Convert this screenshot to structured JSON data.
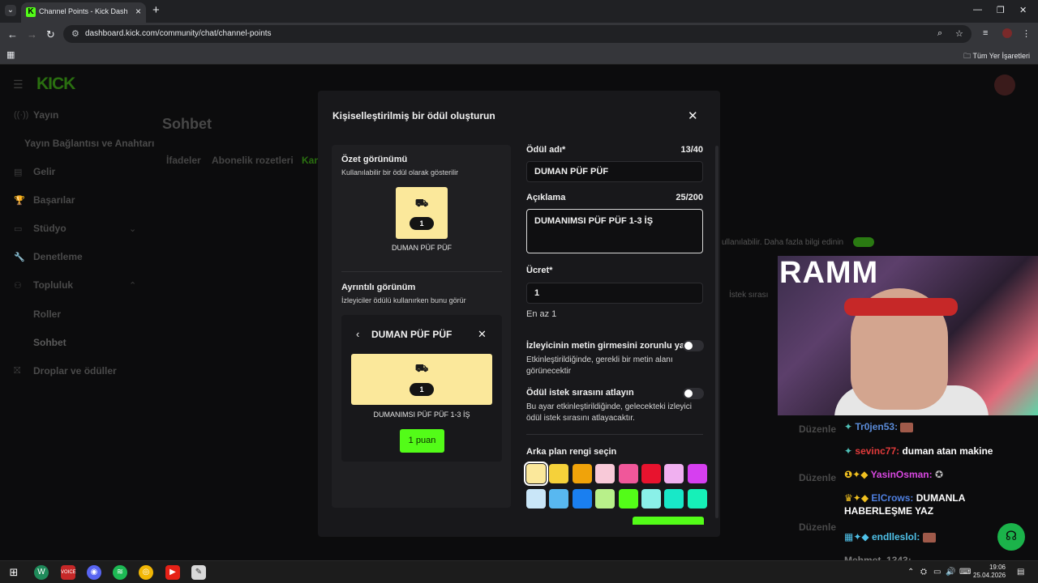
{
  "browser": {
    "tab_title": "Channel Points - Kick Dashboard",
    "url": "dashboard.kick.com/community/chat/channel-points",
    "bookmarks_label": "Tüm Yer İşaretleri"
  },
  "sidebar": {
    "logo": "KICK",
    "items": [
      {
        "label": "Yayın"
      },
      {
        "label": "Yayın Bağlantısı ve Anahtarı"
      },
      {
        "label": "Gelir"
      },
      {
        "label": "Başarılar"
      },
      {
        "label": "Stüdyo"
      },
      {
        "label": "Denetleme"
      },
      {
        "label": "Topluluk"
      },
      {
        "label": "Roller"
      },
      {
        "label": "Sohbet"
      },
      {
        "label": "Droplar ve ödüller"
      }
    ]
  },
  "page": {
    "title": "Sohbet",
    "tabs": [
      "İfadeler",
      "Abonelik rozetleri",
      "Kan"
    ],
    "bg_text_1": "ullanılabilir. Daha fazla bilgi edinin",
    "bg_text_2": "İstek sırası"
  },
  "modal": {
    "title": "Kişiselleştirilmiş bir ödül oluşturun",
    "summary_heading": "Özet görünümü",
    "summary_sub": "Kullanılabilir bir ödül olarak gösterilir",
    "reward_cost_pill": "1",
    "reward_name_preview": "DUMAN PÜF PÜF",
    "detail_heading": "Ayrıntılı görünüm",
    "detail_sub": "İzleyiciler ödülü kullanırken bunu görür",
    "detail_title": "DUMAN PÜF PÜF",
    "detail_desc": "DUMANIMSI PÜF PÜF 1-3 İŞ",
    "points_button": "1 puan",
    "name_label": "Ödül adı*",
    "name_count": "13/40",
    "name_value": "DUMAN PÜF PÜF",
    "desc_label": "Açıklama",
    "desc_count": "25/200",
    "desc_value": "DUMANIMSI PÜF PÜF 1-3 İŞ",
    "cost_label": "Ücret*",
    "cost_value": "1",
    "cost_hint": "En az 1",
    "require_text_label": "İzleyicinin metin girmesini zorunlu yap",
    "require_text_hint": "Etkinleştirildiğinde, gerekli bir metin alanı görünecektir",
    "require_text_on": false,
    "skip_queue_label": "Ödül istek sırasını atlayın",
    "skip_queue_hint": "Bu ayar etkinleştirildiğinde, gelecekteki izleyici ödül istek sırasını atlayacaktır.",
    "skip_queue_on": false,
    "color_label": "Arka plan rengi seçin",
    "colors": [
      "#fbe89b",
      "#f5d13a",
      "#f0a30a",
      "#f8c9d8",
      "#f0579a",
      "#e8132e",
      "#f0b0f0",
      "#d63ff0",
      "#c9e6f8",
      "#58b8f0",
      "#1a7ff0",
      "#b8f08a",
      "#53fc18",
      "#8af0e8",
      "#18e8c8",
      "#16f0b8"
    ],
    "selected_color": "#fbe89b"
  },
  "stream_overlay": {
    "cam_text": "RAMM",
    "edit_label": "Düzenle",
    "chat": [
      {
        "user": "Tr0jen53:",
        "msg": ""
      },
      {
        "user": "sevinc77:",
        "msg": "duman atan makine"
      },
      {
        "user": "YasinOsman:",
        "msg": ""
      },
      {
        "user": "ElCrows:",
        "msg": "DUMANLA HABERLEŞME YAZ"
      },
      {
        "user": "endlleslol:",
        "msg": ""
      },
      {
        "user": "Mehmet_1343:",
        "msg": ""
      }
    ]
  },
  "taskbar": {
    "time": "19:06",
    "date": "25.04.2026"
  }
}
